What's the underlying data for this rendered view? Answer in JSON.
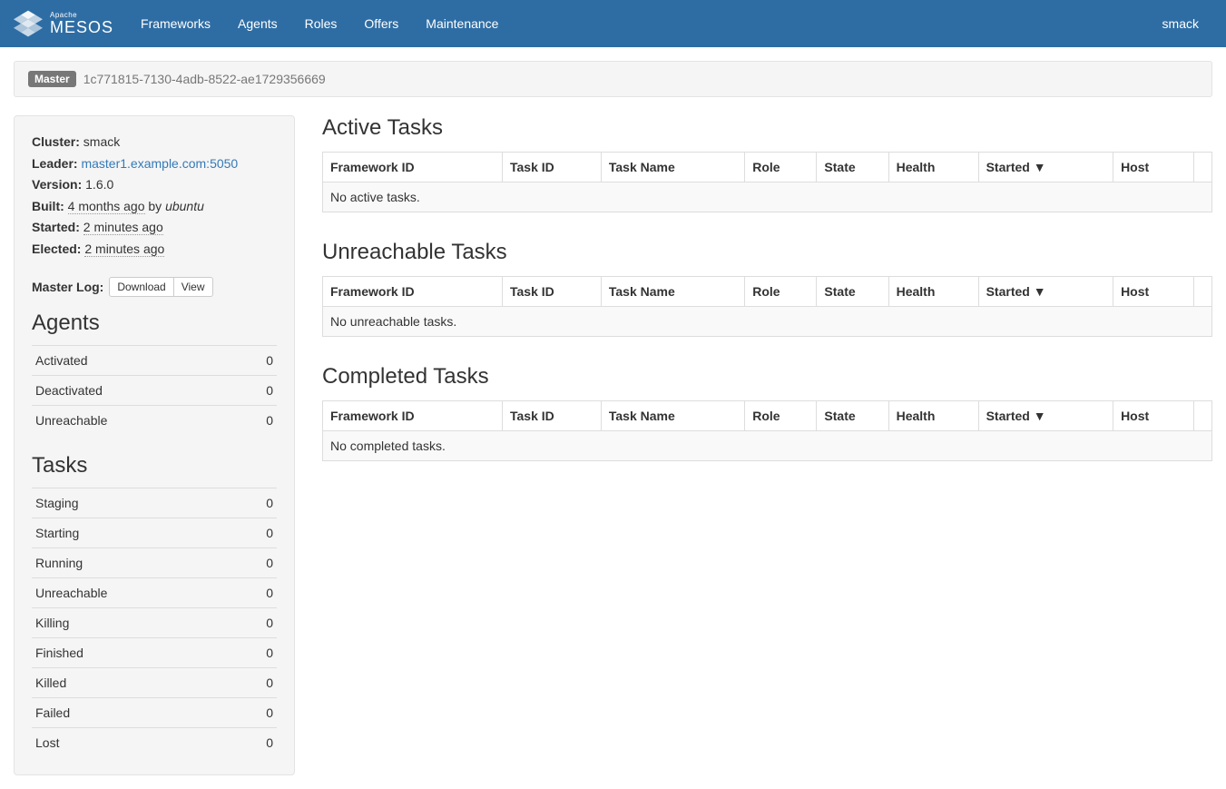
{
  "navbar": {
    "brand_apache": "Apache",
    "brand_name": "MESOS",
    "links": [
      "Frameworks",
      "Agents",
      "Roles",
      "Offers",
      "Maintenance"
    ],
    "right": "smack"
  },
  "master": {
    "label": "Master",
    "id": "1c771815-7130-4adb-8522-ae1729356669"
  },
  "sidebar": {
    "cluster_label": "Cluster:",
    "cluster_value": "smack",
    "leader_label": "Leader:",
    "leader_value": "master1.example.com:5050",
    "version_label": "Version:",
    "version_value": "1.6.0",
    "built_label": "Built:",
    "built_time": "4 months ago",
    "built_by_word": "by",
    "built_user": "ubuntu",
    "started_label": "Started:",
    "started_value": "2 minutes ago",
    "elected_label": "Elected:",
    "elected_value": "2 minutes ago",
    "master_log_label": "Master Log:",
    "download_btn": "Download",
    "view_btn": "View",
    "agents_heading": "Agents",
    "agents": [
      {
        "label": "Activated",
        "value": "0"
      },
      {
        "label": "Deactivated",
        "value": "0"
      },
      {
        "label": "Unreachable",
        "value": "0"
      }
    ],
    "tasks_heading": "Tasks",
    "tasks": [
      {
        "label": "Staging",
        "value": "0"
      },
      {
        "label": "Starting",
        "value": "0"
      },
      {
        "label": "Running",
        "value": "0"
      },
      {
        "label": "Unreachable",
        "value": "0"
      },
      {
        "label": "Killing",
        "value": "0"
      },
      {
        "label": "Finished",
        "value": "0"
      },
      {
        "label": "Killed",
        "value": "0"
      },
      {
        "label": "Failed",
        "value": "0"
      },
      {
        "label": "Lost",
        "value": "0"
      }
    ]
  },
  "columns": {
    "framework_id": "Framework ID",
    "task_id": "Task ID",
    "task_name": "Task Name",
    "role": "Role",
    "state": "State",
    "health": "Health",
    "started": "Started ▼",
    "host": "Host"
  },
  "sections": {
    "active": {
      "heading": "Active Tasks",
      "empty": "No active tasks."
    },
    "unreachable": {
      "heading": "Unreachable Tasks",
      "empty": "No unreachable tasks."
    },
    "completed": {
      "heading": "Completed Tasks",
      "empty": "No completed tasks."
    }
  }
}
